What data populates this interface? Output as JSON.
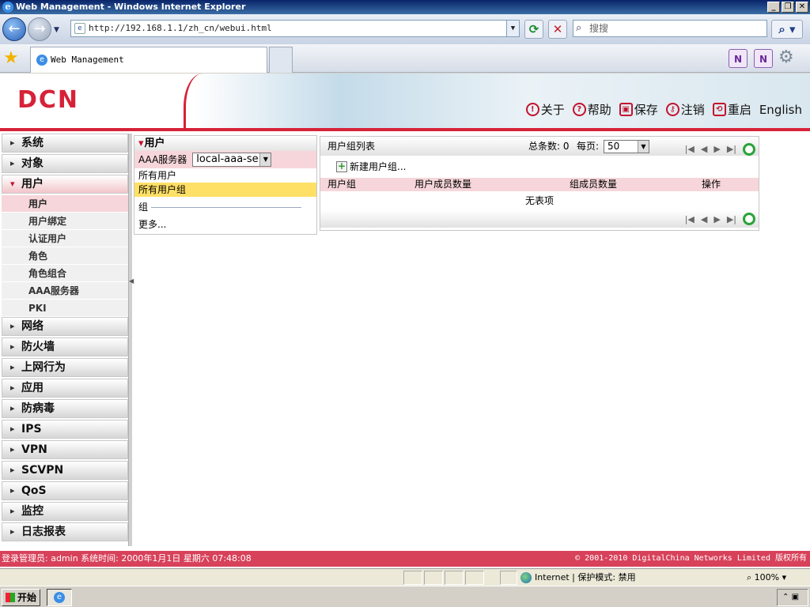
{
  "window": {
    "title": "Web Management - Windows Internet Explorer",
    "controls": [
      "_",
      "❐",
      "✕"
    ]
  },
  "browser": {
    "url": "http://192.168.1.1/zh_cn/webui.html",
    "search_placeholder": "搜搜",
    "tab_title": "Web Management"
  },
  "header": {
    "logo": "DCN",
    "links": [
      {
        "icon": "!",
        "label": "关于"
      },
      {
        "icon": "?",
        "label": "帮助"
      },
      {
        "icon": "▣",
        "label": "保存"
      },
      {
        "icon": "⚷",
        "label": "注销"
      },
      {
        "icon": "⟲",
        "label": "重启"
      },
      {
        "icon": "",
        "label": "English"
      }
    ]
  },
  "sidebar": {
    "groups_top": [
      "系统",
      "对象"
    ],
    "open_group": "用户",
    "sub_items": [
      "用户",
      "用户绑定",
      "认证用户",
      "角色",
      "角色组合",
      "AAA服务器",
      "PKI"
    ],
    "groups_bottom": [
      "网络",
      "防火墙",
      "上网行为",
      "应用",
      "防病毒",
      "IPS",
      "VPN",
      "SCVPN",
      "QoS",
      "监控",
      "日志报表"
    ]
  },
  "user_panel": {
    "title": "用户",
    "aaa_label": "AAA服务器",
    "aaa_value": "local-aaa-se",
    "all_users": "所有用户",
    "all_groups": "所有用户组",
    "group_label": "组",
    "more": "更多..."
  },
  "group_list": {
    "title": "用户组列表",
    "total_label": "总条数: 0",
    "per_page_label": "每页:",
    "page_size": "50",
    "new_group": "新建用户组...",
    "columns": [
      "用户组",
      "用户成员数量",
      "组成员数量",
      "操作"
    ],
    "empty_text": "无表项"
  },
  "footer": {
    "login_info": "登录管理员: admin 系统时间: 2000年1月1日 星期六 07:48:08",
    "copyright": "© 2001-2010 DigitalChina Networks Limited 版权所有"
  },
  "statusbar": {
    "zone": "Internet | 保护模式: 禁用",
    "zoom": "100%"
  },
  "taskbar": {
    "start": "开始"
  }
}
